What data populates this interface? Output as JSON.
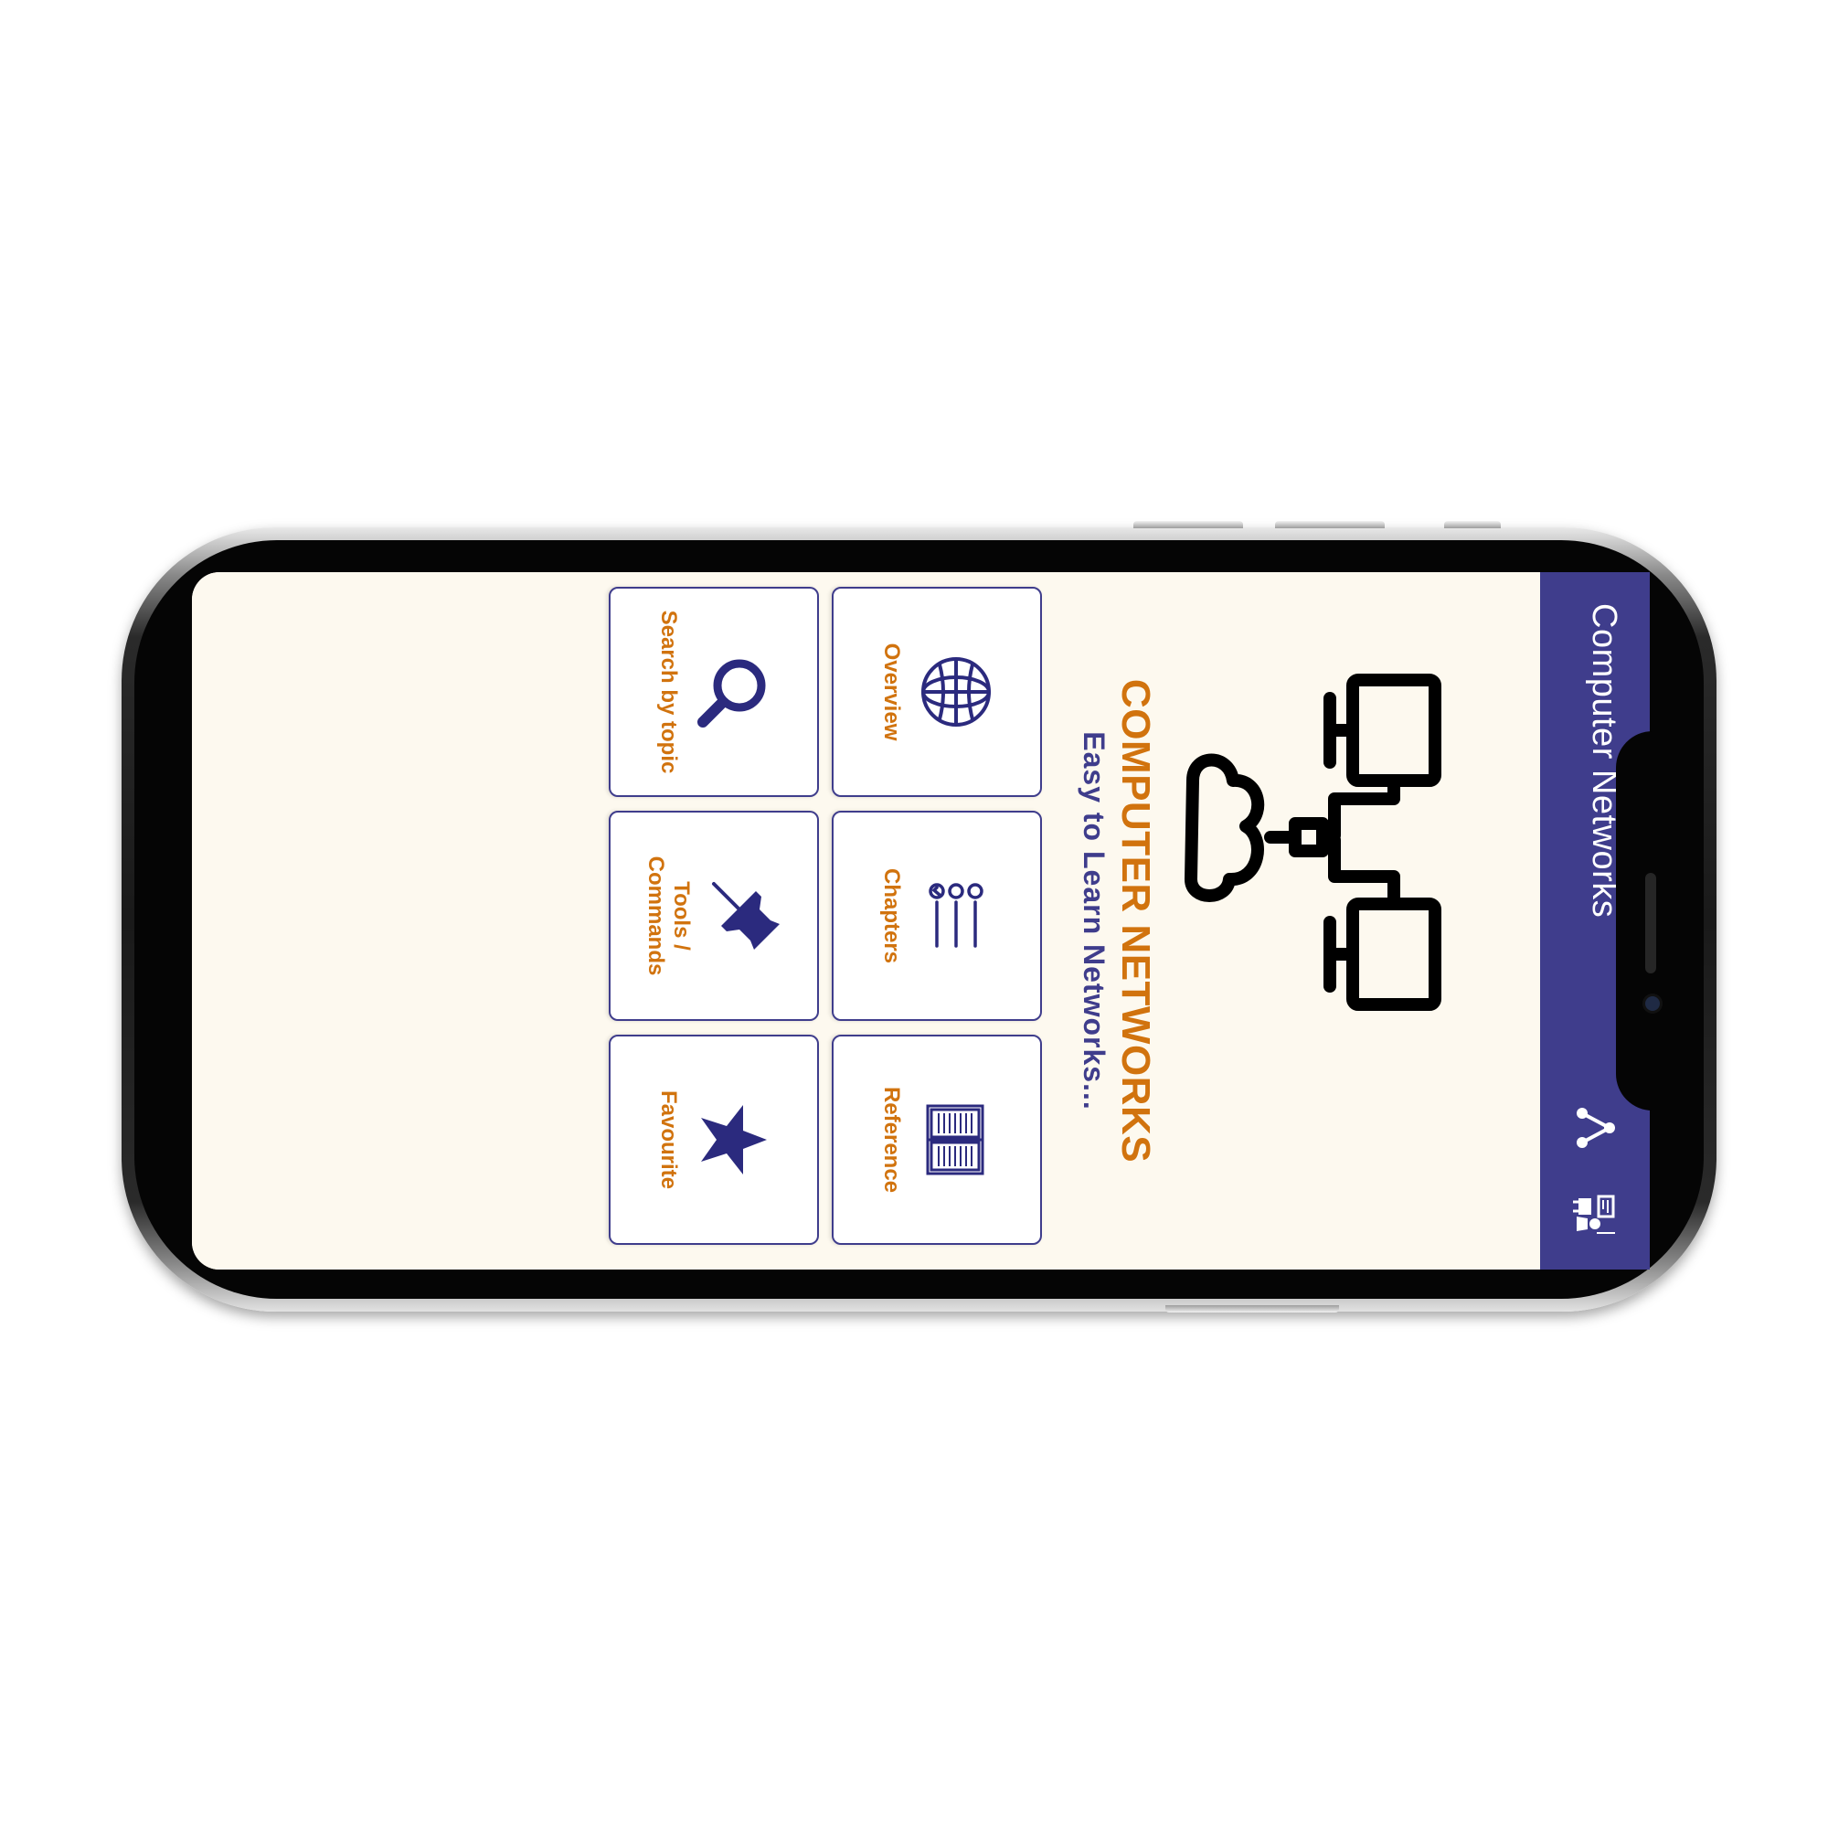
{
  "app": {
    "title": "Computer Networks",
    "icons": {
      "share": "share-icon",
      "tips": "tips-icon"
    }
  },
  "hero": {
    "art": "network-diagram-illustration",
    "title": "COMPUTER NETWORKS",
    "subtitle": "Easy to Learn Networks..."
  },
  "tiles": [
    {
      "label": "Overview",
      "icon": "globe-icon"
    },
    {
      "label": "Chapters",
      "icon": "chapters-list-icon"
    },
    {
      "label": "Reference",
      "icon": "open-book-icon"
    },
    {
      "label": "Search by topic",
      "icon": "magnifier-icon"
    },
    {
      "label": "Tools / Commands",
      "icon": "pushpin-icon"
    },
    {
      "label": "Favourite",
      "icon": "star-icon"
    }
  ],
  "colors": {
    "primary": "#3f3d8c",
    "accent": "#d1730e",
    "background": "#fdf9ef"
  }
}
